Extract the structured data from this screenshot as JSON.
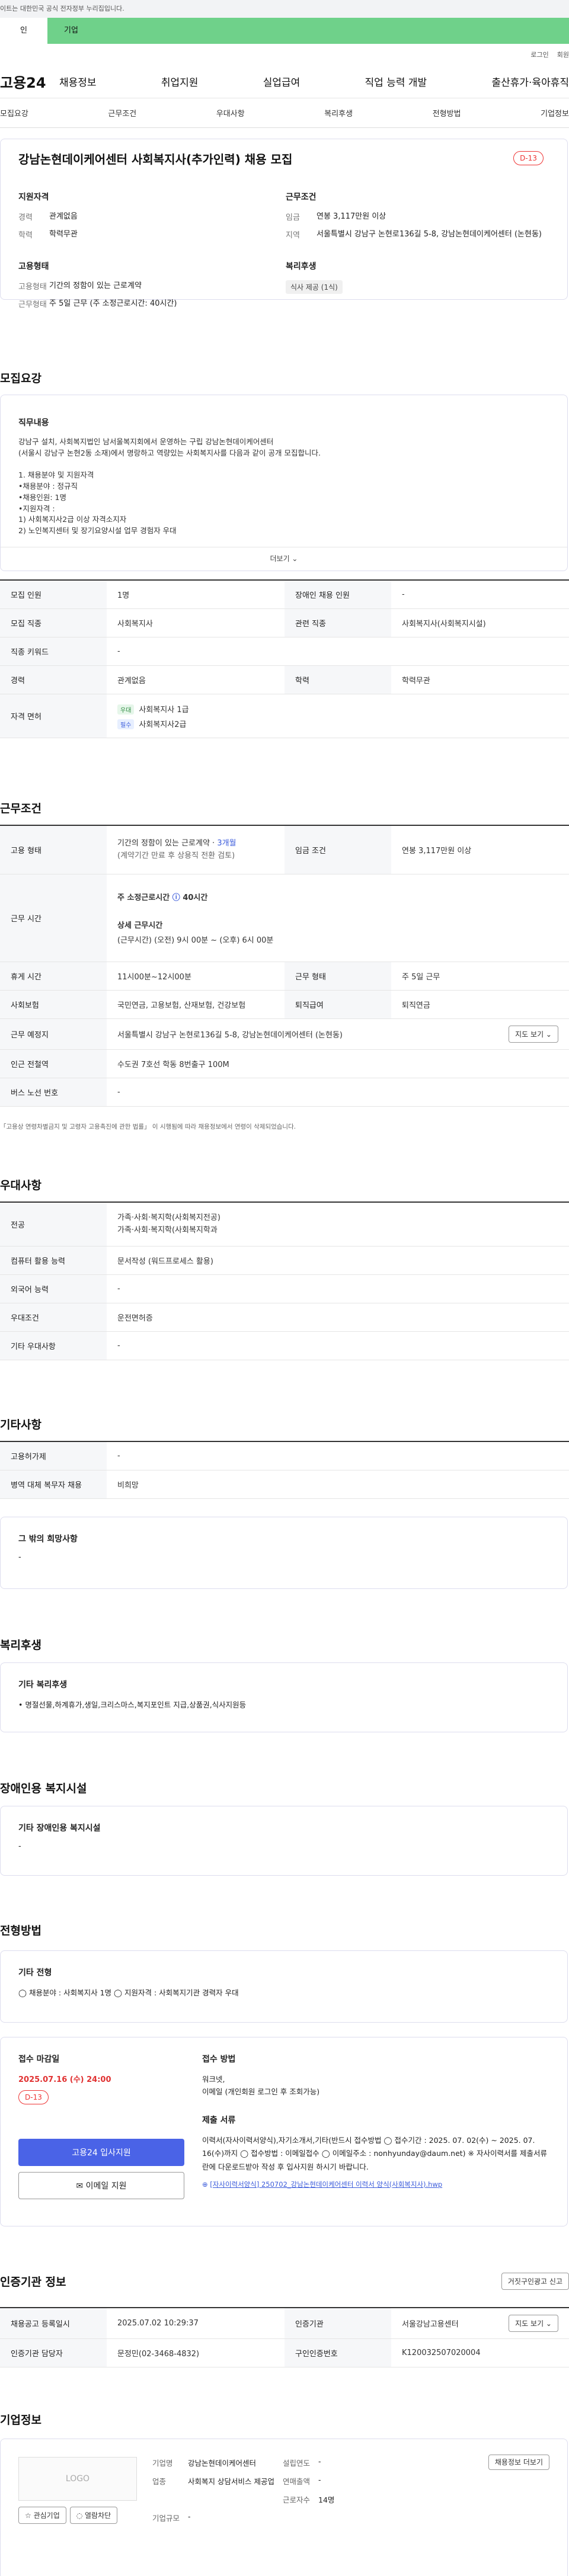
{
  "gov_notice": "이트는 대한민국 공식 전자정부 누리집입니다.",
  "user_tabs": [
    "인",
    "기업"
  ],
  "util_links": [
    "로그인",
    "회원"
  ],
  "logo": "고용24",
  "gnb": [
    "채용정보",
    "취업지원",
    "실업급여",
    "직업 능력 개발",
    "출산휴가·육아휴직"
  ],
  "anchors": [
    "모집요강",
    "근무조건",
    "우대사항",
    "복리후생",
    "전형방법",
    "기업정보"
  ],
  "job": {
    "title": "강남논현데이케어센터 사회복지사(추가인력) 채용 모집",
    "dday": "D-13",
    "qual_title": "지원자격",
    "career_k": "경력",
    "career_v": "관계없음",
    "edu_k": "학력",
    "edu_v": "학력무관",
    "cond_title": "근무조건",
    "wage_k": "임금",
    "wage_v": "연봉 3,117만원 이상",
    "area_k": "지역",
    "area_v": "서울특별시 강남구 논현로136길 5-8, 강남논현데이케어센터 (논현동)",
    "emp_title": "고용형태",
    "emp_k": "고용형태",
    "emp_v": "기간의 정함이 있는 근로계약",
    "hours_k": "근무형태",
    "hours_v": "주 5일 근무 (주 소정근로시간: 40시간)",
    "welfare_title": "복리후생",
    "welfare_tag": "식사 제공 (1식)"
  },
  "recruit": {
    "title": "모집요강",
    "duty_title": "직무내용",
    "desc": [
      "강남구 설치, 사회복지법인 남서울복지회에서 운영하는 구립 강남논현데이케어센터",
      "(서울시 강남구 논현2동 소재)에서 명랑하고 역량있는 사회복지사를 다음과 같이 공개 모집합니다.",
      "",
      "1. 채용분야 및 지원자격",
      "•채용분야 : 정규직",
      "•채용인원: 1명",
      "•지원자격 :",
      "1) 사회복지사2급 이상 자격소지자",
      "2) 노인복지센터 및 장기요양시설 업무 경험자 우대"
    ],
    "more": "더보기 ⌄",
    "rows": [
      [
        "모집 인원",
        "1명",
        "장애인 채용 인원",
        "-"
      ],
      [
        "모집 직종",
        "사회복지사",
        "관련 직종",
        "사회복지사(사회복지시설)"
      ],
      [
        "직종 키워드",
        "-"
      ],
      [
        "경력",
        "관계없음",
        "학력",
        "학력무관"
      ]
    ],
    "license_k": "자격 면허",
    "licenses": [
      {
        "badge": "우대",
        "name": "사회복지사 1급"
      },
      {
        "badge": "필수",
        "name": "사회복지사2급"
      }
    ]
  },
  "work": {
    "title": "근무조건",
    "emp_k": "고용 형태",
    "emp_v1": "기간의 정함이 있는 근로계약 · ",
    "emp_months": "3개월",
    "emp_v2": "(계약기간 만료 후 상용직 전환 검토)",
    "wage_k": "임금 조건",
    "wage_v": "연봉 3,117만원 이상",
    "time_k": "근무 시간",
    "time_total": "주 소정근로시간",
    "time_hours": "40시간",
    "time_detail_t": "상세 근무시간",
    "time_detail": "(근무시간) (오전) 9시 00분 ~ (오후) 6시 00분",
    "break_k": "휴게 시간",
    "break_v": "11시00분~12시00분",
    "shape_k": "근무 형태",
    "shape_v": "주 5일 근무",
    "ins_k": "사회보험",
    "ins_v": "국민연금, 고용보험, 산재보험, 건강보험",
    "ret_k": "퇴직급여",
    "ret_v": "퇴직연금",
    "place_k": "근무 예정지",
    "place_v": "서울특별시 강남구 논현로136길 5-8, 강남논현데이케어센터 (논현동)",
    "map_btn": "지도 보기 ⌄",
    "subway_k": "인근 전철역",
    "subway_v": "수도권 7호선 학동 8번출구 100M",
    "bus_k": "버스 노선 번호",
    "bus_v": "-",
    "note": "「고용상 연령차별금지 및 고령자 고용촉진에 관한 법률」 이 시행됨에 따라 채용정보에서 연령이 삭제되었습니다."
  },
  "pref": {
    "title": "우대사항",
    "rows": [
      [
        "전공",
        "가족·사회·복지학(사회복지전공)\n가족·사회·복지학(사회복지학과"
      ],
      [
        "컴퓨터 활용 능력",
        "문서작성 (워드프로세스 활용)"
      ],
      [
        "외국어 능력",
        "-"
      ],
      [
        "우대조건",
        "운전면허증"
      ],
      [
        "기타 우대사항",
        "-"
      ]
    ]
  },
  "etc": {
    "title": "기타사항",
    "rows": [
      [
        "고용허가제",
        "-"
      ],
      [
        "병역 대체 복무자 채용",
        "비희망"
      ]
    ],
    "hope_t": "그 밖의 희망사항",
    "hope_v": "-"
  },
  "benefit": {
    "title": "복리후생",
    "sub": "기타 복리후생",
    "text": "• 명절선물,하계휴가,생일,크리스마스,복지포인트 지급,상품권,식사지원등"
  },
  "disab": {
    "title": "장애인용 복지시설",
    "sub": "기타 장애인용 복지시설",
    "text": "-"
  },
  "select": {
    "title": "전형방법",
    "sub": "기타 전형",
    "text": "◯ 채용분야 : 사회복지사 1명 ◯ 지원자격 : 사회복지기관 경력자 우대",
    "deadline_t": "접수 마감일",
    "deadline": "2025.07.16 (수) 24:00",
    "dday": "D-13",
    "apply_btn": "고용24 입사지원",
    "email_btn": "✉ 이메일 지원",
    "method_t": "접수 방법",
    "method": "워크넷,\n이메일 (개인회원 로그인 후 조회가능)",
    "docs_t": "제출 서류",
    "docs": "이력서(자사이력서양식),자기소개서,기타(반드시 접수방법 ◯ 접수기간 : 2025. 07. 02(수) ~ 2025. 07. 16(수)까지 ◯ 접수방법 : 이메일접수 ◯ 이메일주소 : nonhyunday@daum.net) ※ 자사이력서를 제출서류란에 다운로드받아 작성 후 입사지원 하시기 바랍니다.",
    "file": "[자사이력서양식] 250702_강남논현데이케어센터 이력서 양식(사회복지사).hwp"
  },
  "cert": {
    "title": "인증기관 정보",
    "report_btn": "거짓구인광고 신고",
    "reg_k": "채용공고 등록일시",
    "reg_v": "2025.07.02 10:29:37",
    "org_k": "인증기관",
    "org_v": "서울강남고용센터",
    "map_btn": "지도 보기 ⌄",
    "mgr_k": "인증기관 담당자",
    "mgr_v": "문정민(02-3468-4832)",
    "no_k": "구인인증번호",
    "no_v": "K120032507020004"
  },
  "company": {
    "title": "기업정보",
    "logo": "LOGO",
    "fav_btn": "☆ 관심기업",
    "block_btn": "◌ 열람차단",
    "name_k": "기업명",
    "name_v": "강남논현데이케어센터",
    "year_k": "설립연도",
    "year_v": "-",
    "ind_k": "업종",
    "ind_v": "사회복지 상담서비스 제공업",
    "sales_k": "연매출액",
    "sales_v": "-",
    "emp_k": "근로자수",
    "emp_v": "14명",
    "size_k": "기업규모",
    "size_v": "-",
    "info_btn": "채용정보 더보기"
  }
}
